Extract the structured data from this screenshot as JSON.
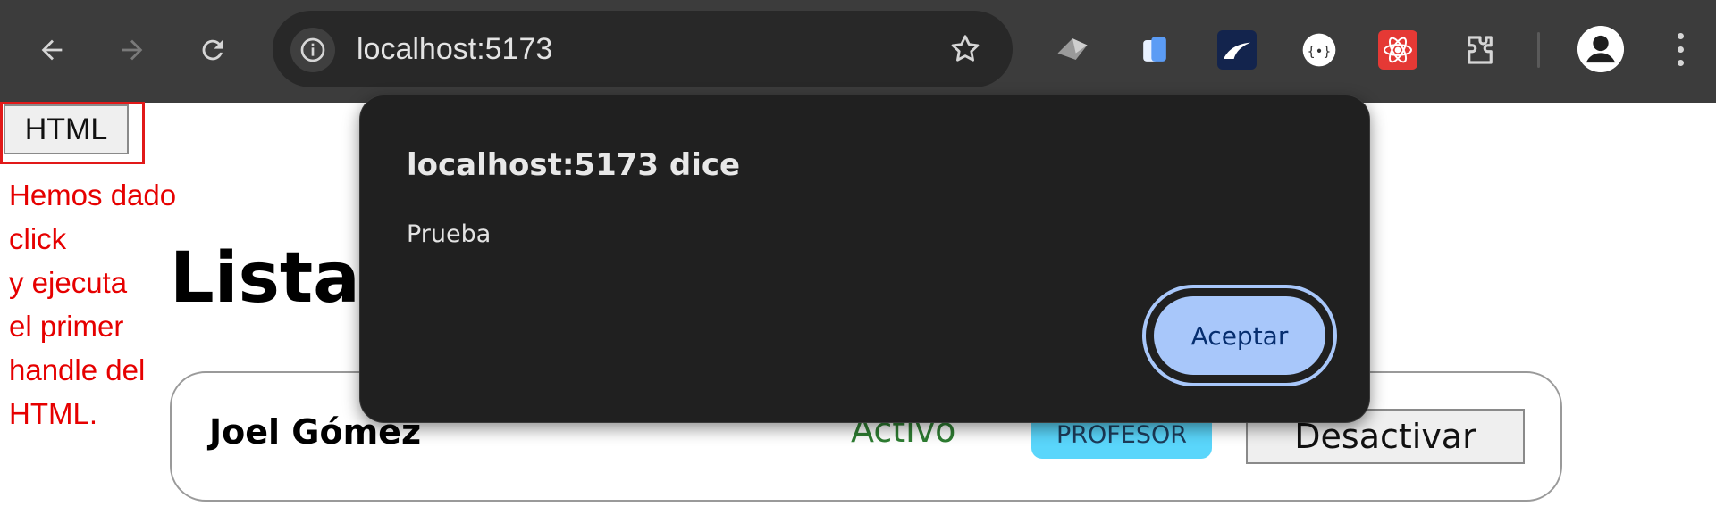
{
  "browser": {
    "url": "localhost:5173",
    "toolbar_color": "#3c3c3c",
    "nav": [
      "arrow-left-icon",
      "arrow-right-icon",
      "reload-icon"
    ],
    "extensions": [
      "extension-1-icon",
      "extension-2-icon",
      "extension-3-icon",
      "extension-4-icon",
      "extension-5-icon",
      "puzzle-icon"
    ]
  },
  "page": {
    "html_button_label": "HTML",
    "annotation_lines": [
      "Hemos dado click",
      "y ejecuta",
      "el primer",
      "handle del",
      "HTML."
    ],
    "title": "Listado",
    "card": {
      "name": "Joel Gómez",
      "status": "Activo",
      "role": "PROFESOR",
      "button_label": "Desactivar"
    }
  },
  "dialog": {
    "title": "localhost:5173 dice",
    "message": "Prueba",
    "accept_label": "Aceptar",
    "accent_color": "#a8c7fa"
  }
}
